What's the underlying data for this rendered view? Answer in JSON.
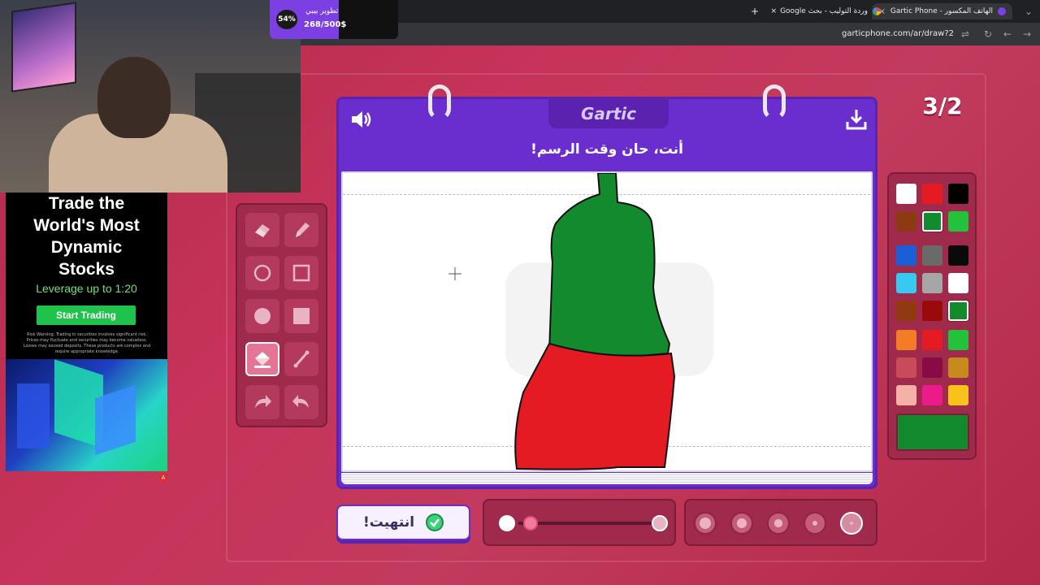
{
  "browser": {
    "tabs": [
      {
        "title": "الهاتف المكسور - Gartic Phone",
        "active": true
      },
      {
        "title": "وردة التوليب - بحث Google",
        "active": false
      }
    ],
    "url": "garticphone.com/ar/draw?2",
    "new_tab": "+",
    "close": "×"
  },
  "stream": {
    "donation": {
      "percent": "54%",
      "title": "تطوير بيبي",
      "amount": "268/500$",
      "progress": 0.54
    }
  },
  "ad": {
    "headline": "Trade the\nWorld's Most\nDynamic\nStocks",
    "leverage": "Leverage up to 1:20",
    "cta": "Start Trading",
    "risk": "Risk Warning: Trading in securities involves significant risk. Prices may fluctuate and securities may become valueless. Losses may exceed deposits. These products are complex and require appropriate knowledge.",
    "badge": "A"
  },
  "game": {
    "round": "3/2",
    "logo": "Gartic",
    "prompt": "أنت، حان وقت الرسم!",
    "done_label": "انتهيت!",
    "tools": [
      {
        "name": "eraser-tool",
        "icon": "eraser-icon",
        "selected": false
      },
      {
        "name": "pencil-tool",
        "icon": "pencil-icon",
        "selected": false
      },
      {
        "name": "ellipse-outline-tool",
        "icon": "circle-outline-icon",
        "selected": false
      },
      {
        "name": "rect-outline-tool",
        "icon": "square-outline-icon",
        "selected": false
      },
      {
        "name": "ellipse-fill-tool",
        "icon": "circle-fill-icon",
        "selected": false
      },
      {
        "name": "rect-fill-tool",
        "icon": "square-fill-icon",
        "selected": false
      },
      {
        "name": "bucket-tool",
        "icon": "paint-bucket-icon",
        "selected": true
      },
      {
        "name": "line-tool",
        "icon": "line-icon",
        "selected": false
      },
      {
        "name": "redo-tool",
        "icon": "redo-icon",
        "selected": false
      },
      {
        "name": "undo-tool",
        "icon": "undo-icon",
        "selected": false
      }
    ],
    "palette": [
      "#ffffff",
      "#e51b23",
      "#000000",
      "#8b3a12",
      "#138a2e",
      "#22c33b",
      "#1b5fd6",
      "#6a6a6a",
      "#0a0a0a",
      "#37c9f0",
      "#a6a6a6",
      "#ffffff",
      "#8f3b0f",
      "#9b0a0a",
      "#138a2e",
      "#f57b24",
      "#e51b23",
      "#22c33b",
      "#c94b5a",
      "#8a0a45",
      "#c78a1c",
      "#f5b0a8",
      "#ec1b8a",
      "#f7c21a"
    ],
    "palette_selected": [
      4,
      14
    ],
    "current_color": "#138a2e",
    "size_value": 0.0,
    "brush_sizes": [
      5,
      4,
      3,
      2,
      1
    ],
    "brush_selected": 4
  },
  "colors": {
    "purple": "#6a2ecf",
    "red_bg": "#c23a5d",
    "green": "#138a2e",
    "red": "#e51b23"
  }
}
